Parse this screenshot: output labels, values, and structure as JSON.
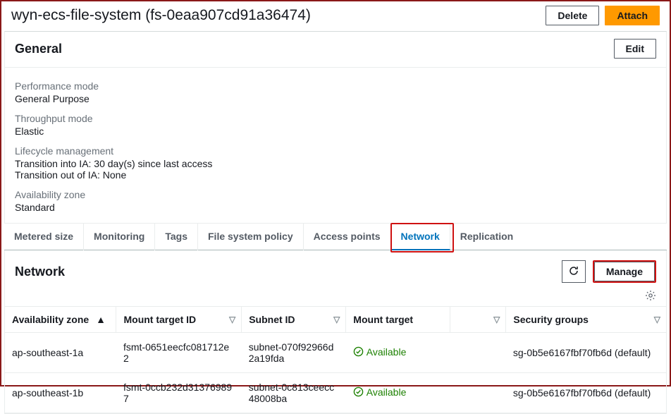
{
  "header": {
    "title": "wyn-ecs-file-system (fs-0eaa907cd91a36474)",
    "delete": "Delete",
    "attach": "Attach"
  },
  "general": {
    "title": "General",
    "edit": "Edit",
    "perf_label": "Performance mode",
    "perf_value": "General Purpose",
    "thr_label": "Throughput mode",
    "thr_value": "Elastic",
    "lc_label": "Lifecycle management",
    "lc_line1": "Transition into IA: 30 day(s) since last access",
    "lc_line2": "Transition out of IA: None",
    "az_label": "Availability zone",
    "az_value": "Standard"
  },
  "tabs": {
    "metered": "Metered size",
    "monitoring": "Monitoring",
    "tags": "Tags",
    "policy": "File system policy",
    "access": "Access points",
    "network": "Network",
    "replication": "Replication"
  },
  "network": {
    "title": "Network",
    "manage": "Manage",
    "cols": {
      "az": "Availability zone",
      "mt": "Mount target ID",
      "subnet": "Subnet ID",
      "state": "Mount target",
      "sg": "Security groups"
    },
    "rows": [
      {
        "az": "ap-southeast-1a",
        "mt": "fsmt-0651eecfc081712e2",
        "subnet": "subnet-070f92966d2a19fda",
        "state": "Available",
        "sg": "sg-0b5e6167fbf70fb6d (default)"
      },
      {
        "az": "ap-southeast-1b",
        "mt": "fsmt-0ccb232d313769897",
        "subnet": "subnet-0c813ceecc48008ba",
        "state": "Available",
        "sg": "sg-0b5e6167fbf70fb6d (default)"
      }
    ]
  }
}
